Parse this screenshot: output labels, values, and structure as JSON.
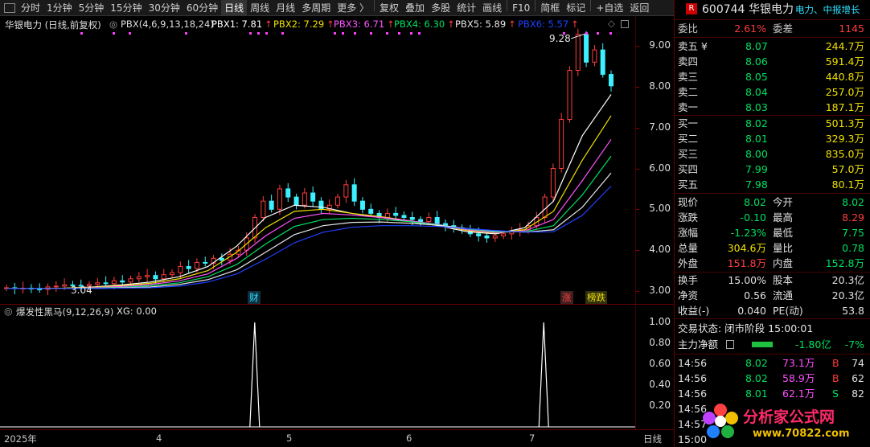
{
  "toolbar": {
    "items": [
      "分时",
      "1分钟",
      "5分钟",
      "15分钟",
      "30分钟",
      "60分钟",
      "日线",
      "周线",
      "月线",
      "多周期",
      "更多 〉",
      "复权",
      "叠加",
      "多股",
      "统计",
      "画线",
      "F10",
      "简框",
      "标记",
      "+自选",
      "返回"
    ],
    "active": "日线"
  },
  "main": {
    "title": "华银电力 (日线,前复权)",
    "indicator": "PBX(4,6,9,13,18,24)",
    "legend": [
      {
        "label": "PBX1: 7.81",
        "color": "#ffffff"
      },
      {
        "label": "PBX2: 7.29",
        "color": "#f0e000"
      },
      {
        "label": "PBX3: 6.71",
        "color": "#ff50ff"
      },
      {
        "label": "PBX4: 6.30",
        "color": "#00e060"
      },
      {
        "label": "PBX5: 5.89",
        "color": "#e6e6e6"
      },
      {
        "label": "PBX6: 5.57",
        "color": "#2040ff"
      }
    ],
    "high_label": "9.28",
    "low_label": "3.04",
    "tag_cai": "财",
    "tag_zhang": "涨",
    "tag_bangdie": "榜跌",
    "price_ticks": [
      "9.00",
      "8.00",
      "7.00",
      "6.00",
      "5.00",
      "4.00",
      "3.00"
    ]
  },
  "sub": {
    "title": "爆发性黑马(9,12,26,9)",
    "xg": "XG: 0.00",
    "ticks": [
      "1.00",
      "0.80",
      "0.60",
      "0.40",
      "0.20"
    ]
  },
  "dates": {
    "labels": [
      "2025年",
      "4",
      "5",
      "6",
      "7"
    ],
    "period": "日线"
  },
  "panel": {
    "code": "600744",
    "name": "华银电力",
    "r_badge": "R",
    "tags": "电力、中报增长",
    "weibi_label": "委比",
    "weibi": "2.61%",
    "weicha_label": "委差",
    "weicha": "1145",
    "sells": [
      {
        "label": "卖五 ¥",
        "price": "8.07",
        "vol": "244.7万"
      },
      {
        "label": "卖四",
        "price": "8.06",
        "vol": "591.4万"
      },
      {
        "label": "卖三",
        "price": "8.05",
        "vol": "440.8万"
      },
      {
        "label": "卖二",
        "price": "8.04",
        "vol": "257.0万"
      },
      {
        "label": "卖一",
        "price": "8.03",
        "vol": "187.1万"
      }
    ],
    "buys": [
      {
        "label": "买一",
        "price": "8.02",
        "vol": "501.3万"
      },
      {
        "label": "买二",
        "price": "8.01",
        "vol": "329.3万"
      },
      {
        "label": "买三",
        "price": "8.00",
        "vol": "835.0万"
      },
      {
        "label": "买四",
        "price": "7.99",
        "vol": "57.0万"
      },
      {
        "label": "买五",
        "price": "7.98",
        "vol": "80.1万"
      }
    ],
    "stats": [
      {
        "l1": "现价",
        "v1": "8.02",
        "c1": "green",
        "l2": "今开",
        "v2": "8.02",
        "c2": "green"
      },
      {
        "l1": "涨跌",
        "v1": "-0.10",
        "c1": "green",
        "l2": "最高",
        "v2": "8.29",
        "c2": "red"
      },
      {
        "l1": "涨幅",
        "v1": "-1.23%",
        "c1": "green",
        "l2": "最低",
        "v2": "7.75",
        "c2": "green"
      },
      {
        "l1": "总量",
        "v1": "304.6万",
        "c1": "yellow",
        "l2": "量比",
        "v2": "0.78",
        "c2": "green"
      },
      {
        "l1": "外盘",
        "v1": "151.8万",
        "c1": "red",
        "l2": "内盘",
        "v2": "152.8万",
        "c2": "green"
      }
    ],
    "stats2": [
      {
        "l1": "换手",
        "v1": "15.00%",
        "l2": "股本",
        "v2": "20.3亿"
      },
      {
        "l1": "净资",
        "v1": "0.56",
        "l2": "流通",
        "v2": "20.3亿"
      },
      {
        "l1": "收益(-)",
        "v1": "0.040",
        "l2": "PE(动)",
        "v2": "53.8"
      }
    ],
    "trade_state": "交易状态: 闭市阶段 15:00:01",
    "main_flow_label": "主力净额",
    "main_flow": "-1.80亿",
    "main_flow_pct": "-7%",
    "ticks": [
      {
        "t": "14:56",
        "p": "8.02",
        "v": "73.1万",
        "d": "B",
        "n": "74"
      },
      {
        "t": "14:56",
        "p": "8.02",
        "v": "58.9万",
        "d": "B",
        "n": "62"
      },
      {
        "t": "14:56",
        "p": "8.01",
        "v": "62.1万",
        "d": "S",
        "n": "82"
      },
      {
        "t": "14:56",
        "p": "",
        "v": "",
        "d": "",
        "n": ""
      },
      {
        "t": "14:57",
        "p": "",
        "v": "",
        "d": "",
        "n": ""
      },
      {
        "t": "15:00",
        "p": "",
        "v": "",
        "d": "",
        "n": ""
      }
    ]
  },
  "watermark": {
    "brand": "分析家公式网",
    "url": "www.70822.com"
  },
  "chart_data": {
    "type": "line",
    "title": "华银电力 (日线,前复权)",
    "xlabel": "",
    "ylabel": "",
    "x_ticks": [
      "2025年",
      "4",
      "5",
      "6",
      "7"
    ],
    "ylim": [
      2.8,
      9.5
    ],
    "candles_close": [
      3.08,
      3.06,
      3.07,
      3.05,
      3.04,
      3.1,
      3.12,
      3.15,
      3.14,
      3.13,
      3.16,
      3.2,
      3.18,
      3.25,
      3.22,
      3.3,
      3.35,
      3.38,
      3.3,
      3.4,
      3.45,
      3.6,
      3.55,
      3.7,
      3.68,
      3.8,
      3.75,
      3.9,
      4.0,
      4.3,
      4.8,
      5.2,
      5.0,
      5.5,
      5.3,
      5.1,
      5.4,
      5.2,
      5.0,
      5.1,
      5.3,
      5.6,
      5.2,
      5.0,
      4.9,
      4.8,
      4.9,
      4.85,
      4.8,
      4.75,
      4.7,
      4.8,
      4.65,
      4.6,
      4.55,
      4.5,
      4.4,
      4.35,
      4.3,
      4.35,
      4.4,
      4.45,
      4.5,
      4.6,
      4.8,
      5.3,
      6.0,
      7.2,
      8.4,
      9.28,
      8.6,
      8.9,
      8.3,
      8.02
    ],
    "series": [
      {
        "name": "PBX1",
        "color": "#ffffff",
        "values": [
          3.06,
          3.06,
          3.07,
          3.1,
          3.15,
          3.22,
          3.35,
          3.6,
          4.1,
          4.8,
          5.1,
          5.05,
          4.9,
          4.8,
          4.7,
          4.6,
          4.45,
          4.4,
          4.55,
          5.2,
          6.8,
          7.81
        ]
      },
      {
        "name": "PBX2",
        "color": "#f0e000",
        "values": [
          3.06,
          3.06,
          3.07,
          3.09,
          3.13,
          3.19,
          3.3,
          3.5,
          3.95,
          4.55,
          4.95,
          5.0,
          4.9,
          4.82,
          4.72,
          4.62,
          4.48,
          4.42,
          4.5,
          4.95,
          6.2,
          7.29
        ]
      },
      {
        "name": "PBX3",
        "color": "#ff50ff",
        "values": [
          3.06,
          3.06,
          3.06,
          3.08,
          3.11,
          3.16,
          3.25,
          3.42,
          3.8,
          4.35,
          4.78,
          4.9,
          4.86,
          4.8,
          4.72,
          4.63,
          4.5,
          4.43,
          4.47,
          4.75,
          5.7,
          6.71
        ]
      },
      {
        "name": "PBX4",
        "color": "#00e060",
        "values": [
          3.06,
          3.06,
          3.06,
          3.07,
          3.09,
          3.13,
          3.2,
          3.35,
          3.65,
          4.15,
          4.58,
          4.75,
          4.78,
          4.75,
          4.7,
          4.62,
          4.52,
          4.45,
          4.45,
          4.6,
          5.35,
          6.3
        ]
      },
      {
        "name": "PBX5",
        "color": "#e6e6e6",
        "values": [
          3.06,
          3.06,
          3.06,
          3.06,
          3.08,
          3.1,
          3.16,
          3.28,
          3.52,
          3.95,
          4.38,
          4.6,
          4.68,
          4.69,
          4.66,
          4.61,
          4.53,
          4.47,
          4.44,
          4.5,
          5.05,
          5.89
        ]
      },
      {
        "name": "PBX6",
        "color": "#2040ff",
        "values": [
          3.06,
          3.06,
          3.06,
          3.06,
          3.07,
          3.08,
          3.12,
          3.22,
          3.42,
          3.78,
          4.18,
          4.44,
          4.56,
          4.6,
          4.6,
          4.58,
          4.53,
          4.48,
          4.44,
          4.45,
          4.85,
          5.57
        ]
      }
    ],
    "indicator": {
      "name": "爆发性黑马",
      "ylim": [
        0,
        1.0
      ],
      "spikes": [
        {
          "x_fraction": 0.401,
          "value": 1.0
        },
        {
          "x_fraction": 0.856,
          "value": 1.0
        }
      ]
    }
  }
}
